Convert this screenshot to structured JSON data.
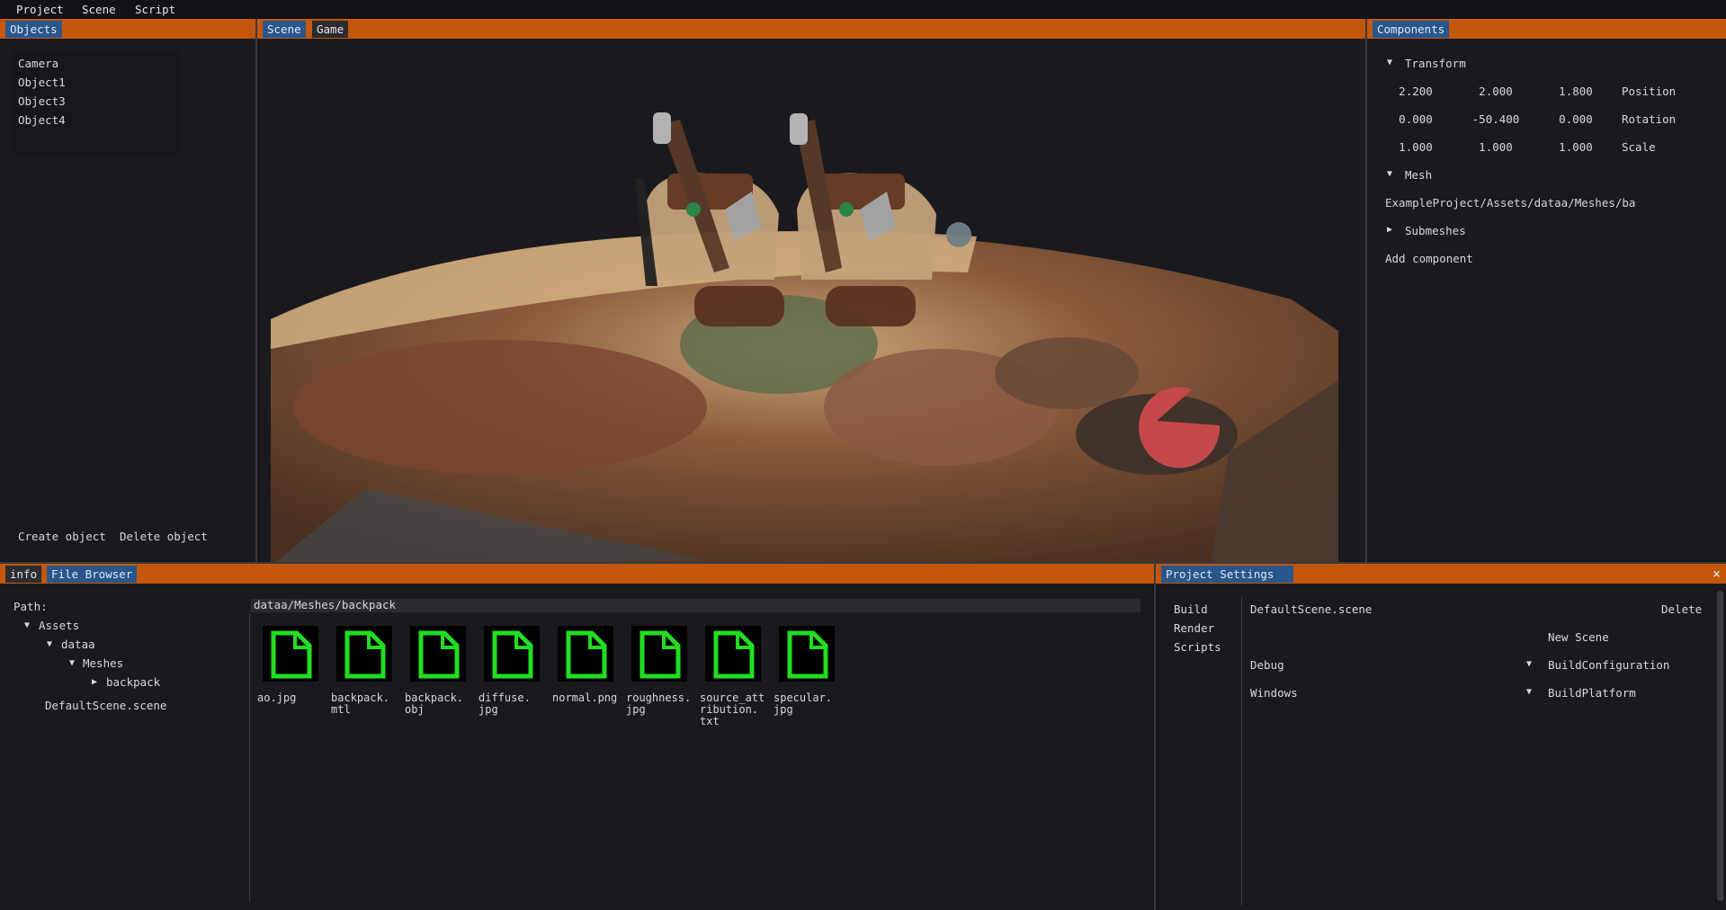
{
  "menubar": {
    "items": [
      "Project",
      "Scene",
      "Script"
    ]
  },
  "objects_panel": {
    "tab": "Objects",
    "items": [
      "Camera",
      "Object1",
      "Object3",
      "Object4"
    ],
    "create_label": "Create object",
    "delete_label": "Delete object"
  },
  "viewport": {
    "tabs": [
      "Scene",
      "Game"
    ]
  },
  "components": {
    "tab": "Components",
    "transform": {
      "header": "Transform",
      "position": {
        "label": "Position",
        "values": [
          "2.200",
          "2.000",
          "1.800"
        ]
      },
      "rotation": {
        "label": "Rotation",
        "values": [
          "0.000",
          "-50.400",
          "0.000"
        ]
      },
      "scale": {
        "label": "Scale",
        "values": [
          "1.000",
          "1.000",
          "1.000"
        ]
      }
    },
    "mesh": {
      "header": "Mesh",
      "path": "ExampleProject/Assets/dataa/Meshes/ba"
    },
    "submeshes": "Submeshes",
    "add_component": "Add component"
  },
  "bottom": {
    "tabs": [
      "info",
      "File Browser"
    ],
    "path_label": "Path:",
    "path_value": "dataa/Meshes/backpack",
    "tree": {
      "assets": "Assets",
      "dataa": "dataa",
      "meshes": "Meshes",
      "backpack": "backpack",
      "scene": "DefaultScene.scene"
    },
    "files": [
      "ao.jpg",
      "backpack.\nmtl",
      "backpack.\nobj",
      "diffuse.\njpg",
      "normal.png",
      "roughness.\njpg",
      "source_att\nribution.\ntxt",
      "specular.\njpg"
    ]
  },
  "project_settings": {
    "tab": "Project Settings",
    "close": "×",
    "nav": [
      "Build",
      "Render",
      "Scripts"
    ],
    "scene_name": "DefaultScene.scene",
    "delete_label": "Delete",
    "new_scene_label": "New Scene",
    "build_config": {
      "value": "Debug",
      "label": "BuildConfiguration"
    },
    "build_platform": {
      "value": "Windows",
      "label": "BuildPlatform"
    }
  },
  "colors": {
    "accent": "#c4570b",
    "tab_active": "#29568b",
    "file_icon": "#22dd22"
  }
}
